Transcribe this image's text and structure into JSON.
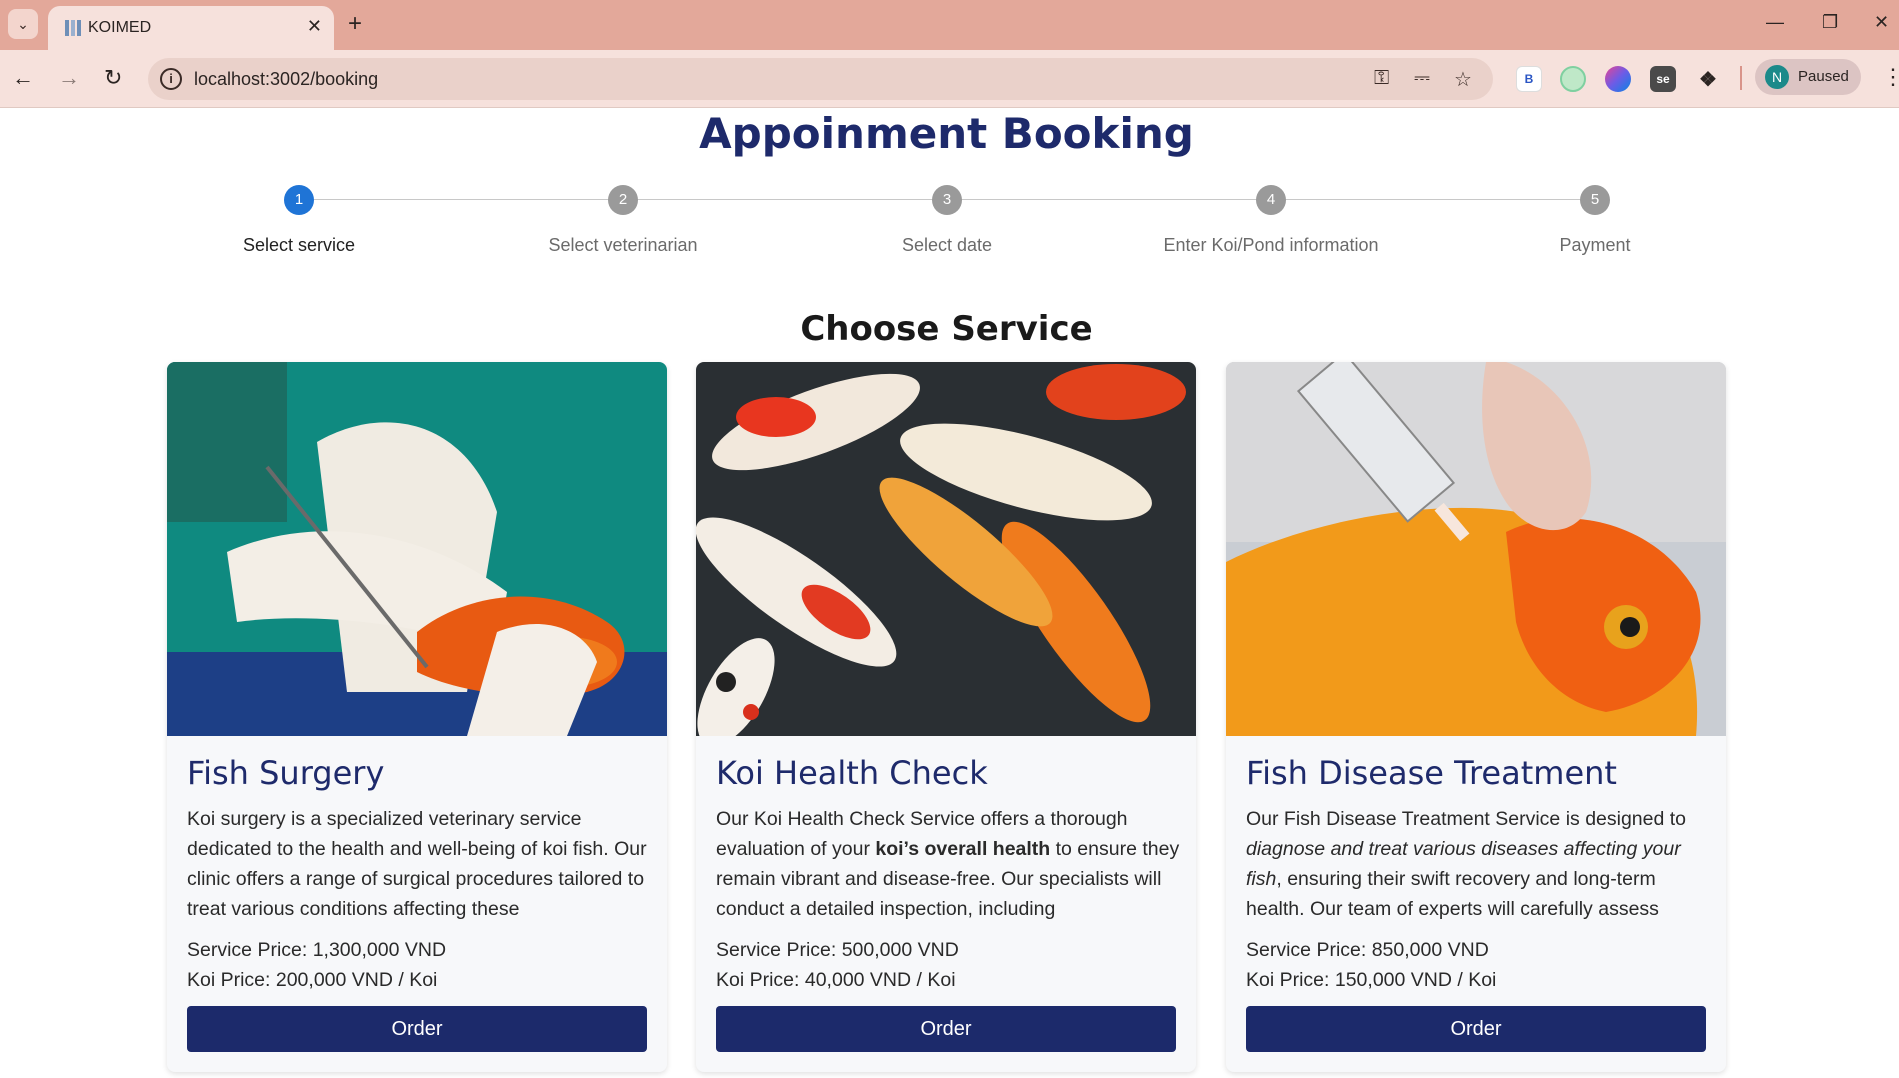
{
  "browser": {
    "tab_title": "KOIMED",
    "url": "localhost:3002/booking",
    "profile_initial": "N",
    "profile_status": "Paused",
    "extensions": [
      "B",
      "se"
    ]
  },
  "page": {
    "title": "Appoinment Booking",
    "section_title": "Choose Service"
  },
  "steps": [
    {
      "number": "1",
      "label": "Select service",
      "active": true
    },
    {
      "number": "2",
      "label": "Select veterinarian",
      "active": false
    },
    {
      "number": "3",
      "label": "Select date",
      "active": false
    },
    {
      "number": "4",
      "label": "Enter Koi/Pond information",
      "active": false
    },
    {
      "number": "5",
      "label": "Payment",
      "active": false
    }
  ],
  "services": [
    {
      "title": "Fish Surgery",
      "description_parts": [
        {
          "text": "Koi surgery is a specialized veterinary service dedicated to the health and well-being of koi fish. Our clinic offers a range of surgical procedures tailored to treat various conditions affecting these",
          "style": "normal"
        }
      ],
      "service_price": "Service Price: 1,300,000 VND",
      "koi_price": "Koi Price: 200,000 VND / Koi",
      "button": "Order",
      "image": "surgery-photo"
    },
    {
      "title": "Koi Health Check",
      "description_parts": [
        {
          "text": "Our Koi Health Check Service offers a thorough evaluation of your ",
          "style": "normal"
        },
        {
          "text": "koi’s overall health",
          "style": "bold"
        },
        {
          "text": " to ensure they remain vibrant and disease-free. Our specialists will conduct a detailed inspection, including",
          "style": "normal"
        }
      ],
      "service_price": "Service Price: 500,000 VND",
      "koi_price": "Koi Price: 40,000 VND / Koi",
      "button": "Order",
      "image": "koi-pond-photo"
    },
    {
      "title": "Fish Disease Treatment",
      "description_parts": [
        {
          "text": "Our Fish Disease Treatment Service is designed to ",
          "style": "normal"
        },
        {
          "text": "diagnose and treat various diseases affecting your fish",
          "style": "italic"
        },
        {
          "text": ", ensuring their swift recovery and long-term health. Our team of experts will carefully assess",
          "style": "normal"
        }
      ],
      "service_price": "Service Price: 850,000 VND",
      "koi_price": "Koi Price: 150,000 VND / Koi",
      "button": "Order",
      "image": "injection-photo"
    }
  ],
  "colors": {
    "brand_navy": "#1c2a6b",
    "step_active": "#1f74d6",
    "step_inactive": "#9a9a9a",
    "chrome": "#e3a89a"
  }
}
